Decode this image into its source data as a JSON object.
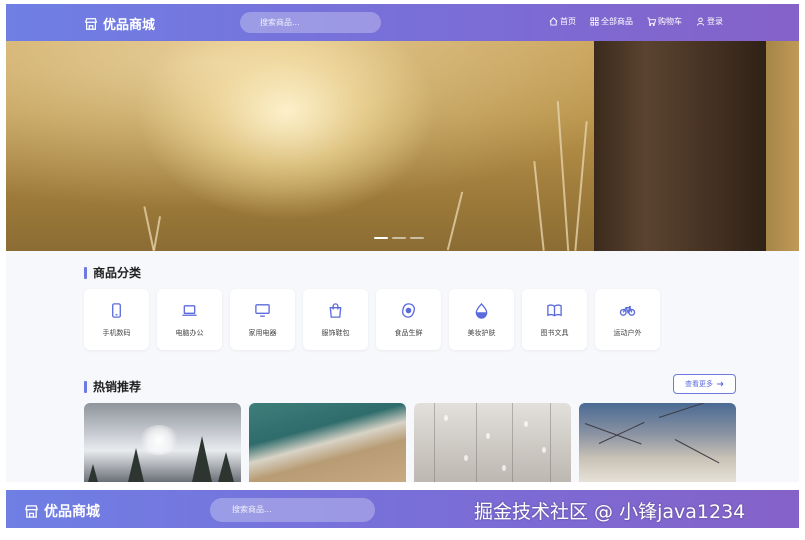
{
  "header": {
    "logo_text": "优品商城",
    "logo_icon": "store-icon",
    "search_placeholder": "搜索商品...",
    "nav": [
      {
        "label": "首页",
        "icon": "home-icon"
      },
      {
        "label": "全部商品",
        "icon": "grid-icon"
      },
      {
        "label": "购物车",
        "icon": "cart-icon"
      },
      {
        "label": "登录",
        "icon": "user-icon"
      }
    ]
  },
  "banner": {
    "slide_count": 3,
    "active_slide": 1
  },
  "categories": {
    "title": "商品分类",
    "items": [
      {
        "label": "手机数码",
        "icon": "phone-icon"
      },
      {
        "label": "电脑办公",
        "icon": "laptop-icon"
      },
      {
        "label": "家用电器",
        "icon": "monitor-icon"
      },
      {
        "label": "服饰鞋包",
        "icon": "bag-icon"
      },
      {
        "label": "食品生鲜",
        "icon": "egg-icon"
      },
      {
        "label": "美妆护肤",
        "icon": "droplet-icon"
      },
      {
        "label": "图书文具",
        "icon": "book-icon"
      },
      {
        "label": "运动户外",
        "icon": "bicycle-icon"
      }
    ]
  },
  "hot": {
    "title": "热销推荐",
    "more_label": "查看更多",
    "more_icon": "arrow-right-icon"
  },
  "clone_header": {
    "logo_text": "优品商城",
    "search_placeholder": "搜索商品..."
  },
  "watermark": "掘金技术社区 @ 小锋java1234",
  "colors": {
    "accent": "#6d7ae0",
    "header_start": "#6f7fe4",
    "header_end": "#8562c8"
  }
}
